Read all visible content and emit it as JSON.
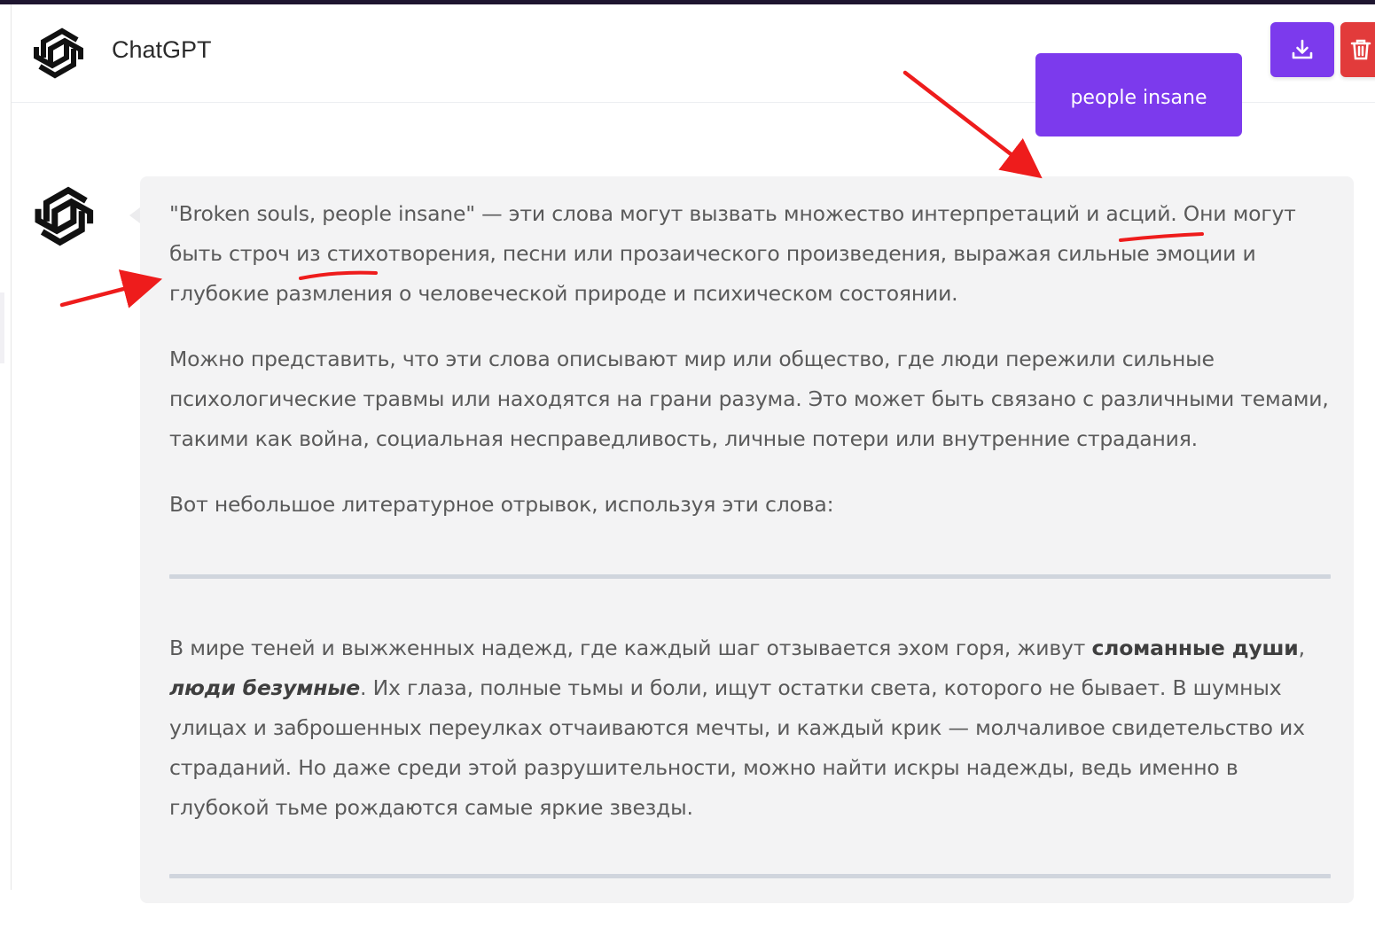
{
  "app": {
    "title": "ChatGPT",
    "logo_icon": "openai-knot-icon"
  },
  "toolbar": {
    "download_icon": "download-icon",
    "delete_icon": "trash-icon",
    "download_color": "#7c3aed",
    "delete_color": "#e23b3b"
  },
  "user_message": {
    "text": "people insane"
  },
  "assistant_message": {
    "avatar_icon": "openai-knot-icon",
    "p1": "\"Broken souls, people insane\" — эти слова могут вызвать множество интерпретаций и асций. Они могут быть строч из стихотворения, песни или прозаического произведения, выражая сильные эмоции и глубокие размления о человеческой природе и психическом состоянии.",
    "p2": "Можно представить, что эти слова описывают мир или общество, где люди пережили сильные психологические травмы или находятся на грани разума. Это может быть связано с различными темами, такими как война, социальная несправедливость, личные потери или внутренние страдания.",
    "p3": "Вот небольшое литературное отрывок, используя эти слова:",
    "p4_start": "В мире теней и выжженных надежд, где каждый шаг отзывается эхом горя, живут ",
    "p4_bold": "сломанные души",
    "p4_comma": ", ",
    "p4_bold_italic": "люди безумные",
    "p4_rest": ". Их глаза, полные тьмы и боли, ищут остатки света, которого не бывает. В шумных улицах и заброшенных переулках отчаиваются мечты, и каждый крик — молчаливое свидетельство их страданий. Но даже среди этой разрушительности, можно найти искры надежды, ведь именно в глубокой тьме рождаются самые яркие звезды."
  },
  "annotation_color": "#ee1c1c"
}
